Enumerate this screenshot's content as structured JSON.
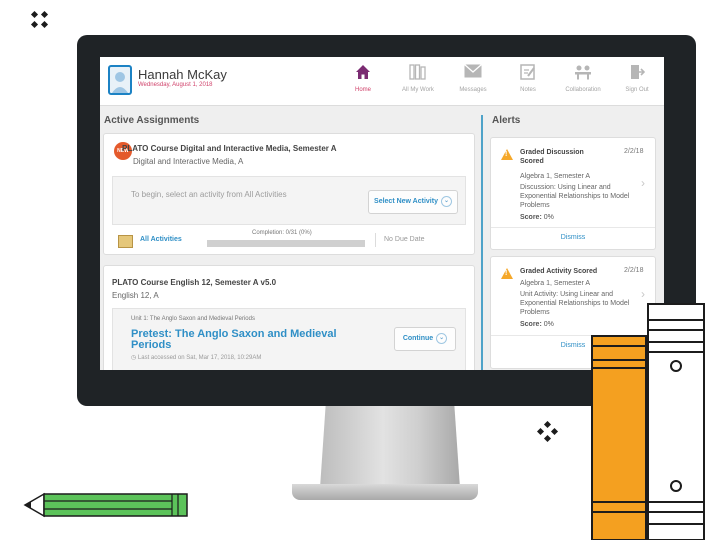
{
  "header": {
    "user_name": "Hannah McKay",
    "date": "Wednesday, August 1, 2018",
    "nav": [
      {
        "label": "Home",
        "icon": "home-icon",
        "active": true
      },
      {
        "label": "All My Work",
        "icon": "books-icon",
        "active": false
      },
      {
        "label": "Messages",
        "icon": "envelope-icon",
        "active": false
      },
      {
        "label": "Notes",
        "icon": "notes-icon",
        "active": false
      },
      {
        "label": "Collaboration",
        "icon": "collaboration-icon",
        "active": false
      },
      {
        "label": "Sign Out",
        "icon": "sign-out-icon",
        "active": false
      }
    ]
  },
  "active_assignments": {
    "title": "Active Assignments",
    "course1": {
      "badge": "NEW",
      "title": "PLATO Course Digital and Interactive Media, Semester A",
      "subtitle": "Digital and Interactive Media, A",
      "hint": "To begin, select an activity from All Activities",
      "select_button": "Select New Activity",
      "all_activities": "All Activities",
      "completion_label": "Completion: 0/31 (0%)",
      "completion_fraction": 0,
      "due_date": "No Due Date"
    },
    "course2": {
      "title": "PLATO Course English 12, Semester A v5.0",
      "subtitle": "English 12, A",
      "unit": "Unit 1: The Anglo Saxon and Medieval Periods",
      "lesson": "Pretest: The Anglo Saxon and Medieval Periods",
      "last_accessed": "Last accessed on Sat, Mar 17, 2018, 10:29AM",
      "continue_button": "Continue"
    }
  },
  "alerts": {
    "title": "Alerts",
    "items": [
      {
        "title": "Graded Discussion Scored",
        "date": "2/2/18",
        "course": "Algebra 1, Semester A",
        "description": "Discussion: Using Linear and Exponential Relationships to Model Problems",
        "score_label": "Score:",
        "score_value": "0%",
        "dismiss": "Dismiss"
      },
      {
        "title": "Graded Activity Scored",
        "date": "2/2/18",
        "course": "Algebra 1, Semester A",
        "description": "Unit Activity: Using Linear and Exponential Relationships to Model Problems",
        "score_label": "Score:",
        "score_value": "0%",
        "dismiss": "Dismiss"
      }
    ]
  },
  "colors": {
    "accent_blue": "#2f8fc6",
    "brand_magenta": "#d0426b",
    "warning": "#f5a82a",
    "pencil_green": "#5cc35a",
    "book_orange": "#f4a020"
  }
}
